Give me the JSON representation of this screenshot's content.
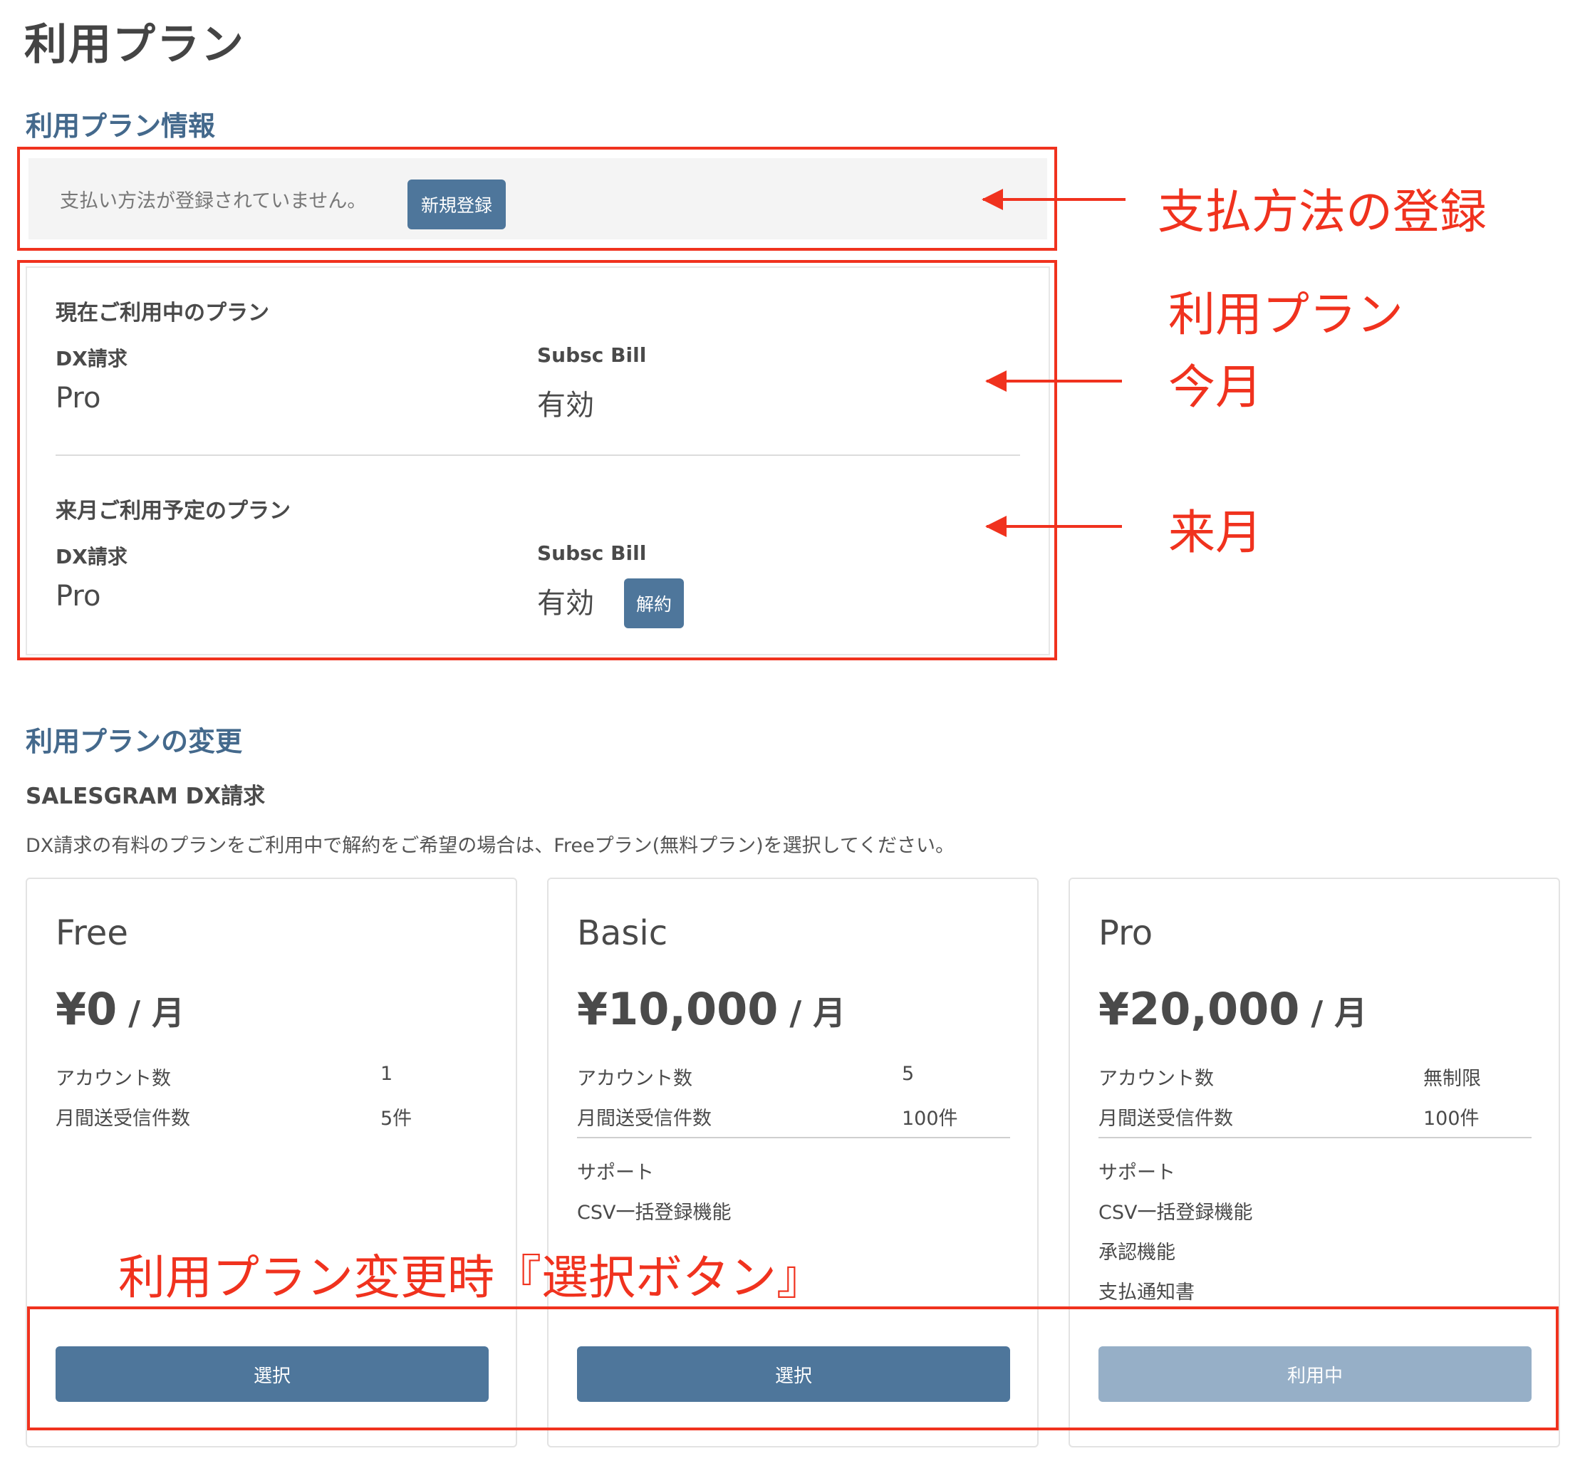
{
  "page": {
    "title": "利用プラン"
  },
  "plan_info": {
    "heading": "利用プラン情報",
    "payment_message": "支払い方法が登録されていません。",
    "register_button": "新規登録",
    "current": {
      "title": "現在ご利用中のプラン",
      "dx_label": "DX請求",
      "dx_value": "Pro",
      "subsc_label": "Subsc Bill",
      "subsc_value": "有効"
    },
    "next": {
      "title": "来月ご利用予定のプラン",
      "dx_label": "DX請求",
      "dx_value": "Pro",
      "subsc_label": "Subsc Bill",
      "subsc_value": "有効",
      "cancel_button": "解約"
    }
  },
  "plan_change": {
    "heading": "利用プランの変更",
    "subheading": "SALESGRAM DX請求",
    "description": "DX請求の有料のプランをご利用中で解約をご希望の場合は、Freeプラン(無料プラン)を選択してください。",
    "cards": [
      {
        "name": "Free",
        "price": "¥0",
        "unit": " / 月",
        "accounts_label": "アカウント数",
        "accounts_value": "1",
        "messages_label": "月間送受信件数",
        "messages_value": "5件",
        "features": [],
        "button": "選択"
      },
      {
        "name": "Basic",
        "price": "¥10,000",
        "unit": " / 月",
        "accounts_label": "アカウント数",
        "accounts_value": "5",
        "messages_label": "月間送受信件数",
        "messages_value": "100件",
        "features": [
          "サポート",
          "CSV一括登録機能"
        ],
        "button": "選択"
      },
      {
        "name": "Pro",
        "price": "¥20,000",
        "unit": " / 月",
        "accounts_label": "アカウント数",
        "accounts_value": "無制限",
        "messages_label": "月間送受信件数",
        "messages_value": "100件",
        "features": [
          "サポート",
          "CSV一括登録機能",
          "承認機能",
          "支払通知書"
        ],
        "button": "利用中"
      }
    ]
  },
  "annotations": {
    "payment": "支払方法の登録",
    "plan": "利用プラン",
    "this_month": "今月",
    "next_month": "来月",
    "select_button": "利用プラン変更時『選択ボタン』",
    "color": "#f0321e"
  },
  "colors": {
    "accent": "#4e769b",
    "heading": "#44698c",
    "disabled": "#96afc7"
  }
}
